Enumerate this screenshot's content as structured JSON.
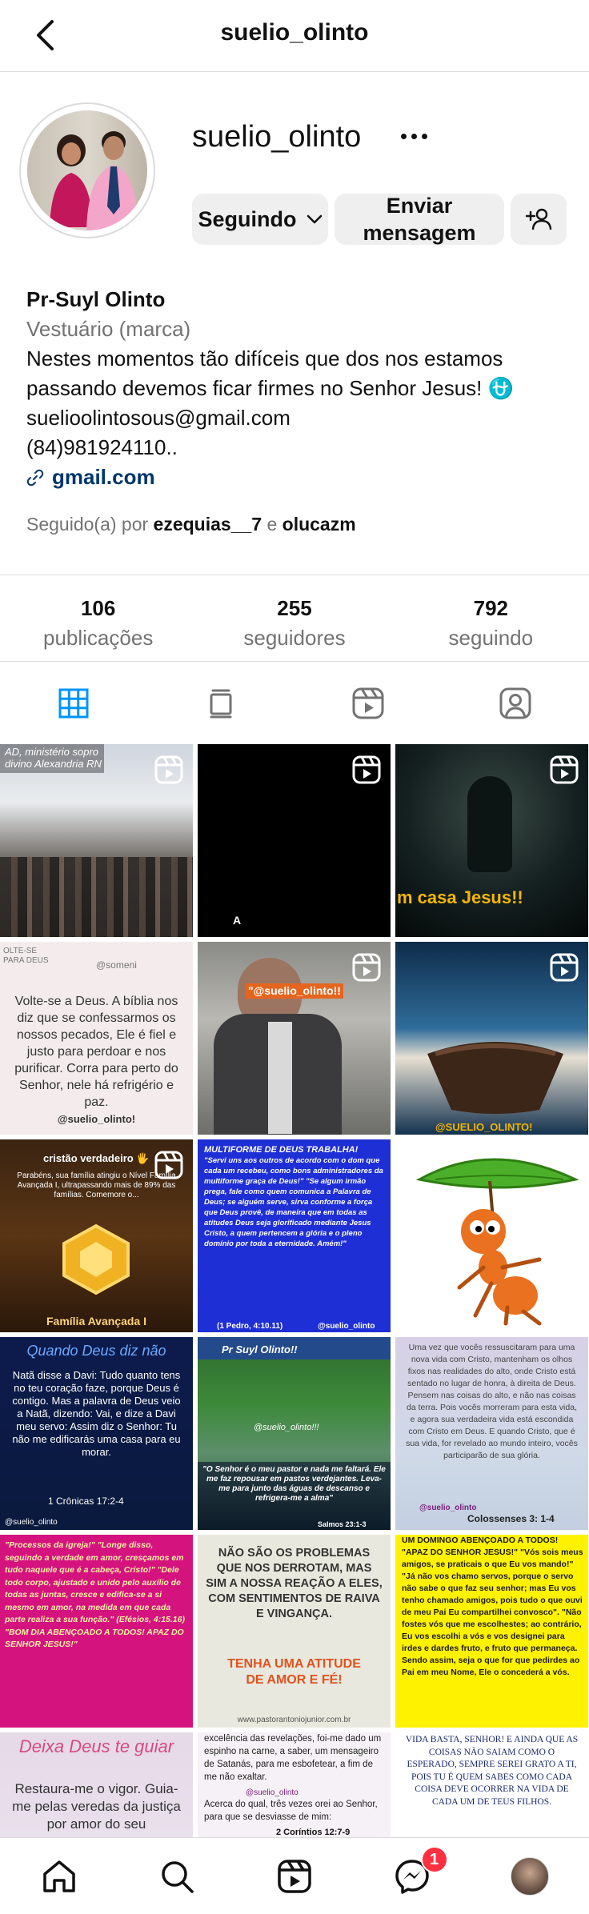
{
  "header": {
    "title": "suelio_olinto"
  },
  "profile": {
    "username": "suelio_olinto",
    "following_label": "Seguindo",
    "message_label": "Enviar mensagem",
    "display_name": "Pr-Suyl Olinto",
    "category": "Vestuário (marca)",
    "bio_line1": "Nestes momentos tão difíceis que dos nos estamos passando devemos ficar firmes no Senhor Jesus! ⛎",
    "bio_email": "suelioolintosous@gmail.com",
    "bio_phone": "(84)981924110..",
    "link": "gmail.com",
    "followed_by_prefix": "Seguido(a) por",
    "followed_by_1": "ezequias__7",
    "followed_by_and": "e",
    "followed_by_2": "olucazm"
  },
  "stats": [
    {
      "value": "106",
      "label": "publicações"
    },
    {
      "value": "255",
      "label": "seguidores"
    },
    {
      "value": "792",
      "label": "seguindo"
    }
  ],
  "posts": {
    "p1": {
      "text": "AD, ministério sopro divino Alexandria RN"
    },
    "p3": {
      "text": "m casa Jesus!!"
    },
    "p4": {
      "text": "Volte-se a Deus. A bíblia nos diz que se confessarmos os nossos pecados, Ele é fiel e justo para perdoar e nos purificar. Corra para perto do Senhor, nele há refrigério e paz.",
      "handle": "@suelio_olinto!",
      "corner": "OLTE-SE PARA DEUS",
      "tag": "@someni"
    },
    "p5": {
      "text": "\"@suelio_olinto!!"
    },
    "p6": {
      "text": "@SUELIO_OLINTO!"
    },
    "p7": {
      "title": "cristão verdadeiro 🖐",
      "text": "Parabéns, sua família atingiu o Nível Família Avançada I, ultrapassando mais de 89% das famílias. Comemore o...",
      "footer": "Família Avançada I"
    },
    "p8": {
      "title": "MULTIFORME DE DEUS TRABALHA!",
      "text": "\"Servi uns aos outros de acordo com o dom que cada um recebeu, como bons administradores da multiforme graça de Deus!\" \"Se algum irmão prega, fale como quem comunica a Palavra de Deus; se alguém serve, sirva conforme a força que Deus provê, de maneira que em todas as atitudes Deus seja glorificado mediante Jesus Cristo, a quem pertencem a glória e o pleno domínio por toda a eternidade. Amém!\"",
      "ref": "(1 Pedro, 4:10.11)",
      "handle": "@suelio_olinto"
    },
    "p10": {
      "title": "Quando Deus diz não",
      "text": "Natã disse a Davi: Tudo quanto tens no teu coração faze, porque Deus é contigo. Mas a palavra de Deus veio a Natã, dizendo: Vai, e dize a Davi meu servo: Assim diz o Senhor: Tu não me edificarás uma casa para eu morar.",
      "ref": "1 Crônicas 17:2-4",
      "handle": "@suelio_olinto"
    },
    "p11": {
      "header": "Pr Suyl Olinto!!",
      "mid": "@suelio_olinto!!!",
      "text": "\"O Senhor é o meu pastor e nada me faltará. Ele me faz repousar em pastos verdejantes. Leva-me para junto das águas de descanso e refrigera-me a alma\"",
      "ref": "Salmos 23:1-3"
    },
    "p12": {
      "text": "Uma vez que vocês ressuscitaram para uma nova vida com Cristo, mantenham os olhos fixos nas realidades do alto, onde Cristo está sentado no lugar de honra, à direita de Deus. Pensem nas coisas do alto, e não nas coisas da terra. Pois vocês morreram para esta vida, e agora sua verdadeira vida está escondida com Cristo em Deus. E quando Cristo, que é sua vida, for revelado ao mundo inteiro, vocês participarão de sua glória.",
      "handle": "@suelio_olinto",
      "ref": "Colossenses 3: 1-4"
    },
    "p13": {
      "text": "\"Processos da igreja!\" \"Longe disso, seguindo a verdade em amor, cresçamos em tudo naquele que é a cabeça, Cristo!\" \"Dele todo corpo, ajustado e unido pelo auxílio de todas as juntas, cresce e edifica-se a si mesmo em amor, na medida em que cada parte realiza a sua função.\" (Efésios, 4:15.16) \"BOM DIA ABENÇOADO A TODOS! APAZ DO SENHOR JESUS!\""
    },
    "p14": {
      "title": "NÃO SÃO OS PROBLEMAS QUE NOS DERROTAM, MAS SIM A NOSSA REAÇÃO A ELES, COM SENTIMENTOS DE RAIVA E VINGANÇA.",
      "accent": "TENHA UMA ATITUDE DE AMOR E FÉ!",
      "footer": "www.pastorantoniojunior.com.br"
    },
    "p15": {
      "text": "UM DOMINGO ABENÇOADO A TODOS! \"APAZ DO SENHOR JESUS!\" \"Vós sois meus amigos, se praticais o que Eu vos mando!\" \"Já não vos chamo servos, porque o servo não sabe o que faz seu senhor; mas Eu vos tenho chamado amigos, pois tudo o que ouvi de meu Pai Eu compartilhei convosco\". \"Não fostes vós que me escolhestes; ao contrário, Eu vos escolhi a vós e vos designei para irdes e dardes fruto, e fruto que permaneça. Sendo assim, seja o que for que pedirdes ao Pai em meu Nome, Ele o concederá a vós."
    },
    "p16": {
      "title": "Deixa Deus te guiar",
      "text": "Restaura-me o vigor. Guia-me pelas veredas da justiça por amor do seu"
    },
    "p17": {
      "text": "excelência das revelações, foi-me dado um espinho na carne, a saber, um mensageiro de Satanás, para me esbofetear, a fim de me não exaltar.",
      "handle": "@suelio_olinto",
      "text2": "Acerca do qual, três vezes orei ao Senhor, para que se desviasse de mim:",
      "ref": "2 Coríntios 12:7-9"
    },
    "p18": {
      "text": "VIDA BASTA, SENHOR! E AINDA QUE AS COISAS NÃO SAIAM COMO O ESPERADO, SEMPRE SEREI GRATO A TI, POIS TU É QUEM SABES COMO CADA COISA DEVE OCORRER NA VIDA DE CADA UM DE TEUS FILHOS."
    }
  },
  "nav": {
    "badge": "1"
  },
  "colors": {
    "link": "#00376b",
    "secondary_text": "#737373",
    "button_bg": "#efefef",
    "active_tab": "#0095f6",
    "badge": "#ff3040"
  }
}
